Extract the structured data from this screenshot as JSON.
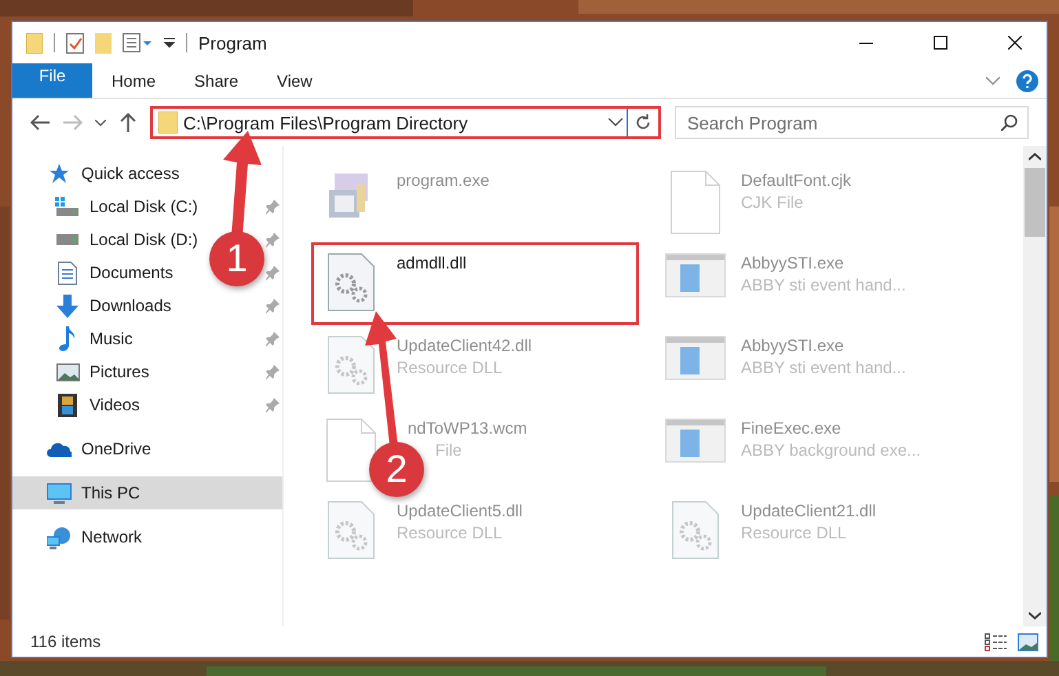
{
  "window": {
    "title": "Program"
  },
  "ribbon": {
    "tabs": [
      {
        "label": "File",
        "kind": "file"
      },
      {
        "label": "Home",
        "kind": "tab"
      },
      {
        "label": "Share",
        "kind": "tab"
      },
      {
        "label": "View",
        "kind": "tab"
      }
    ]
  },
  "address": {
    "path": "C:\\Program Files\\Program Directory",
    "highlighted": true
  },
  "search": {
    "placeholder": "Search Program"
  },
  "sidebar": {
    "items": [
      {
        "label": "Quick access",
        "kind": "star",
        "selected": false,
        "children": [
          {
            "label": "Local Disk (C:)",
            "kind": "system-disk",
            "pinned": true,
            "selected": false
          },
          {
            "label": "Local Disk (D:)",
            "kind": "disk",
            "pinned": true,
            "selected": false
          },
          {
            "label": "Documents",
            "kind": "documents",
            "pinned": true,
            "selected": false
          },
          {
            "label": "Downloads",
            "kind": "downloads",
            "pinned": true,
            "selected": false
          },
          {
            "label": "Music",
            "kind": "music",
            "pinned": true,
            "selected": false
          },
          {
            "label": "Pictures",
            "kind": "pictures",
            "pinned": true,
            "selected": false
          },
          {
            "label": "Videos",
            "kind": "videos",
            "pinned": true,
            "selected": false
          }
        ]
      },
      {
        "label": "OneDrive",
        "kind": "cloud",
        "selected": false
      },
      {
        "label": "This PC",
        "kind": "pc",
        "selected": true
      },
      {
        "label": "Network",
        "kind": "network",
        "selected": false
      }
    ]
  },
  "files": [
    {
      "name": "program.exe",
      "kind": "installer",
      "dimmed": true,
      "highlighted": false
    },
    {
      "name": "DefaultFont.cjk",
      "type": "CJK File",
      "kind": "blank",
      "dimmed": true,
      "highlighted": false
    },
    {
      "name": "admdll.dll",
      "kind": "gears",
      "dimmed": false,
      "highlighted": true
    },
    {
      "name": "AbbyySTI.exe",
      "type": "ABBY sti event hand...",
      "kind": "app",
      "dimmed": true,
      "highlighted": false
    },
    {
      "name": "UpdateClient42.dll",
      "type": "Resource DLL",
      "kind": "gears",
      "dimmed": true,
      "highlighted": false
    },
    {
      "name": "AbbyySTI.exe",
      "type": "ABBY sti event hand...",
      "kind": "app",
      "dimmed": true,
      "highlighted": false
    },
    {
      "name": "ndToWP13.wcm",
      "type": "File",
      "kind": "blank",
      "dimmed": true,
      "highlighted": false
    },
    {
      "name": "FineExec.exe",
      "type": "ABBY background exe...",
      "kind": "app",
      "dimmed": true,
      "highlighted": false
    },
    {
      "name": "UpdateClient5.dll",
      "type": "Resource DLL",
      "kind": "gears",
      "dimmed": true,
      "highlighted": false
    },
    {
      "name": "UpdateClient21.dll",
      "type": "Resource DLL",
      "kind": "gears",
      "dimmed": true,
      "highlighted": false
    }
  ],
  "status_bar": {
    "count": "116 items"
  },
  "annotations": [
    {
      "label": "1"
    },
    {
      "label": "2"
    }
  ]
}
